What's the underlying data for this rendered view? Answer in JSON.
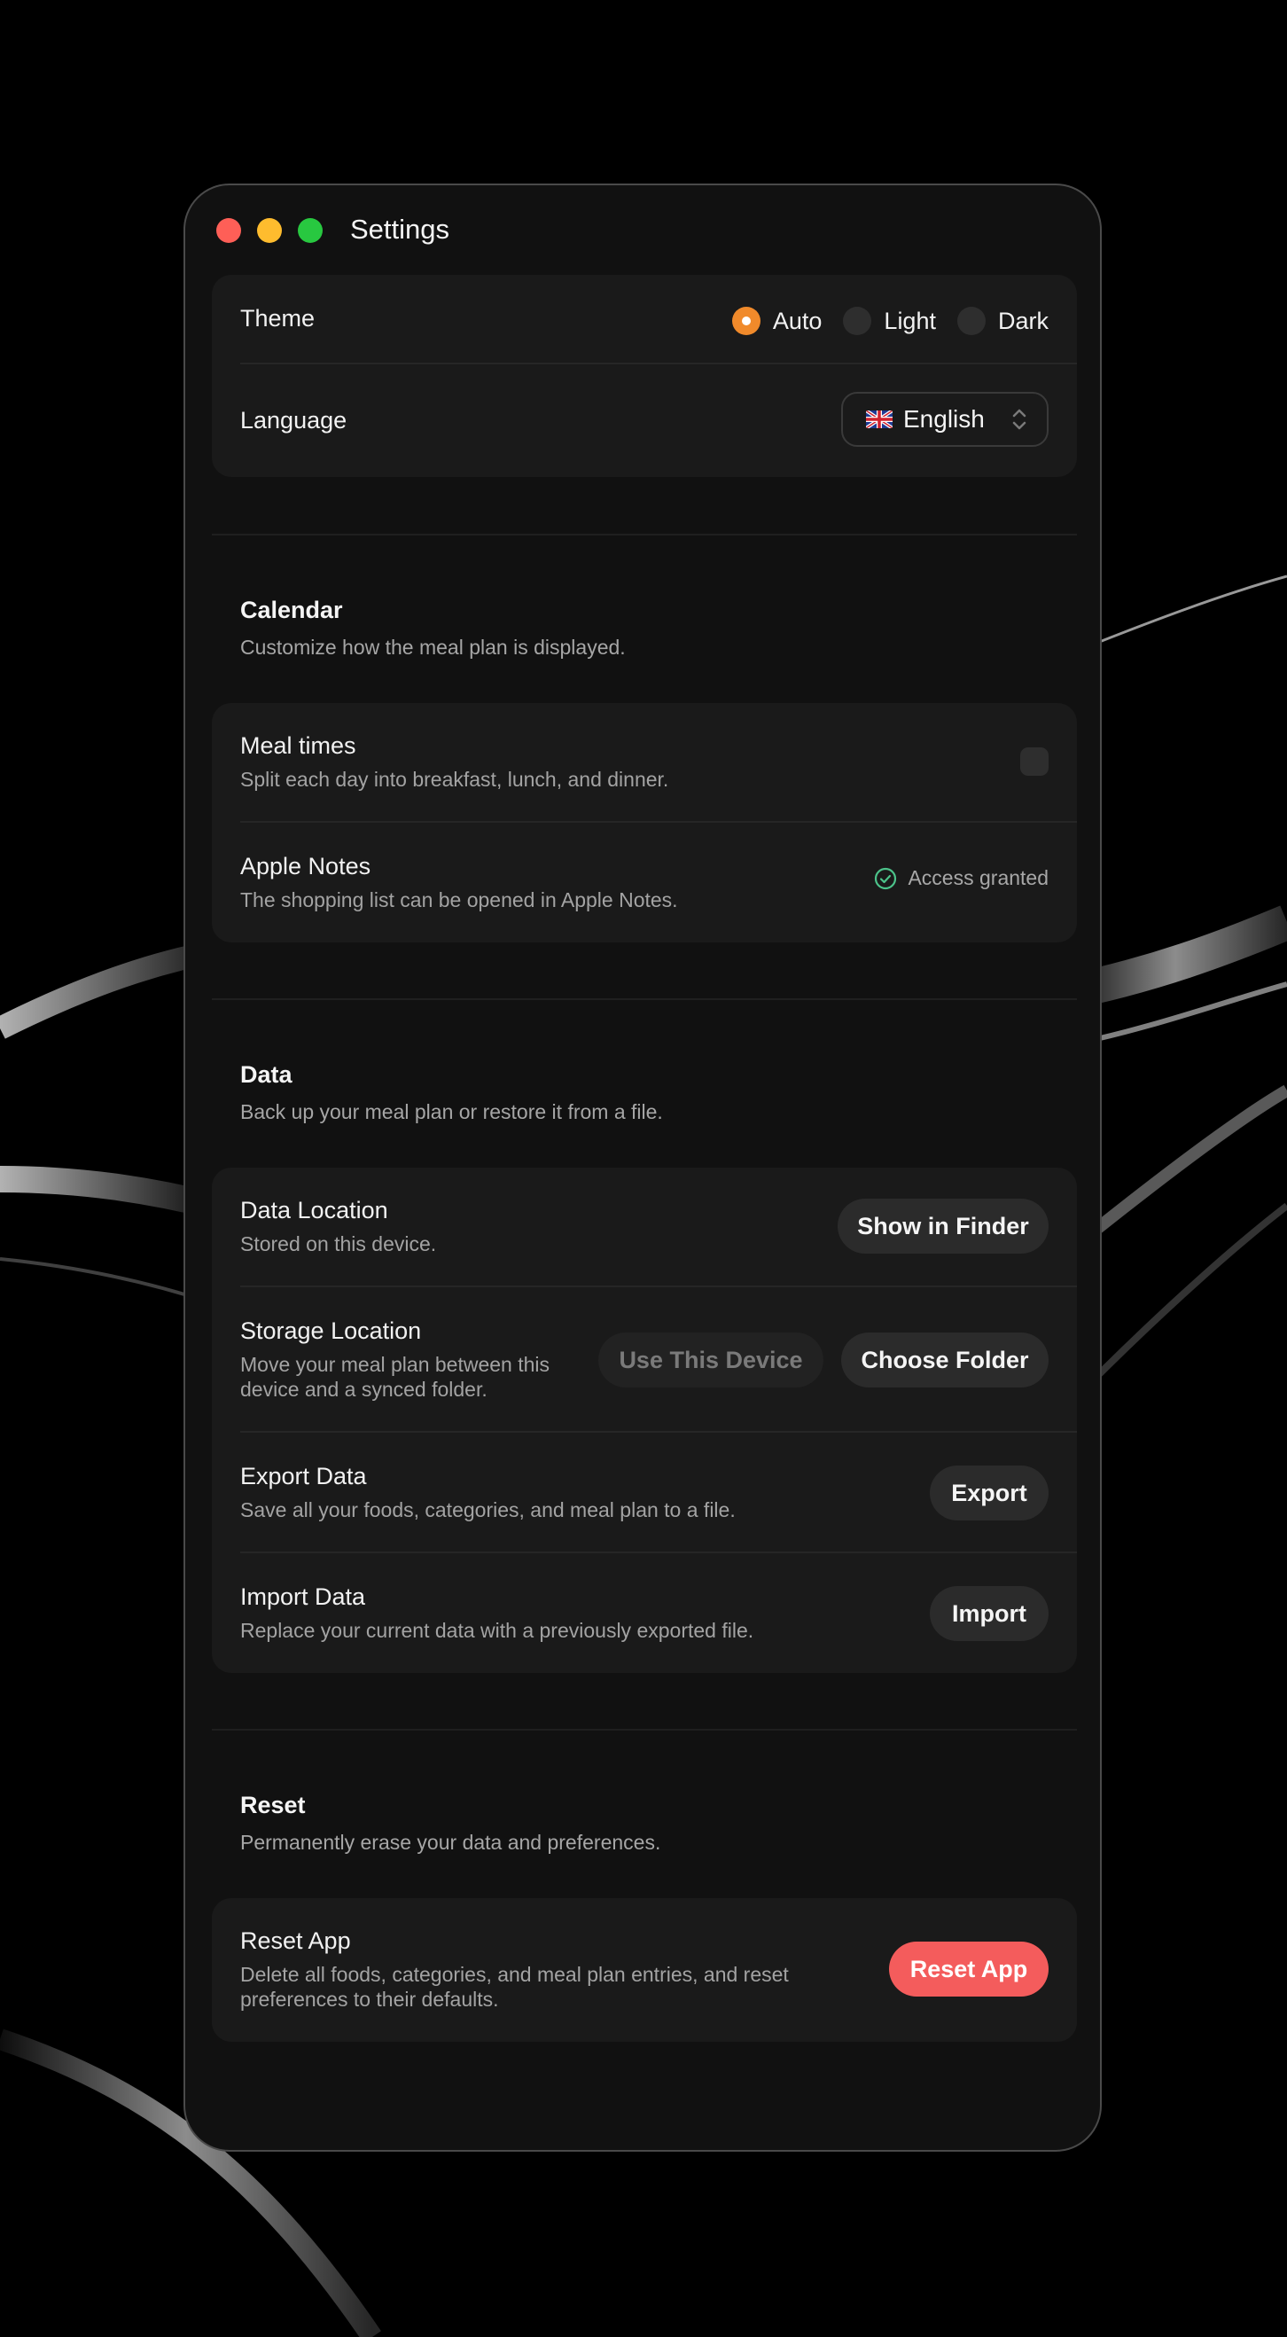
{
  "window": {
    "title": "Settings"
  },
  "appearance": {
    "theme_label": "Theme",
    "theme_options": [
      {
        "label": "Auto",
        "selected": true
      },
      {
        "label": "Light",
        "selected": false
      },
      {
        "label": "Dark",
        "selected": false
      }
    ],
    "language_label": "Language",
    "language_value": "English"
  },
  "calendar": {
    "title": "Calendar",
    "description": "Customize how the meal plan is displayed.",
    "meal_times": {
      "label": "Meal times",
      "description": "Split each day into breakfast, lunch, and dinner.",
      "enabled": false
    },
    "apple_notes": {
      "label": "Apple Notes",
      "description": "The shopping list can be opened in Apple Notes.",
      "status": "Access granted"
    }
  },
  "data": {
    "title": "Data",
    "description": "Back up your meal plan or restore it from a file.",
    "data_location": {
      "label": "Data Location",
      "description": "Stored on this device.",
      "button": "Show in Finder"
    },
    "storage_location": {
      "label": "Storage Location",
      "description_line1": "Move your meal plan between this",
      "description_line2": "device and a synced folder.",
      "use_device_button": "Use This Device",
      "choose_folder_button": "Choose Folder"
    },
    "export": {
      "label": "Export Data",
      "description": "Save all your foods, categories, and meal plan to a file.",
      "button": "Export"
    },
    "import": {
      "label": "Import Data",
      "description": "Replace your current data with a previously exported file.",
      "button": "Import"
    }
  },
  "reset": {
    "title": "Reset",
    "description": "Permanently erase your data and preferences.",
    "reset_app": {
      "label": "Reset App",
      "description_line1": "Delete all foods, categories, and meal plan entries, and reset",
      "description_line2": "preferences to their defaults.",
      "button": "Reset App"
    }
  },
  "colors": {
    "accent": "#f08a2b",
    "danger": "#f45c5c",
    "success": "#4cc38a",
    "window_bg": "#111111",
    "card_bg": "#1a1a1a"
  }
}
